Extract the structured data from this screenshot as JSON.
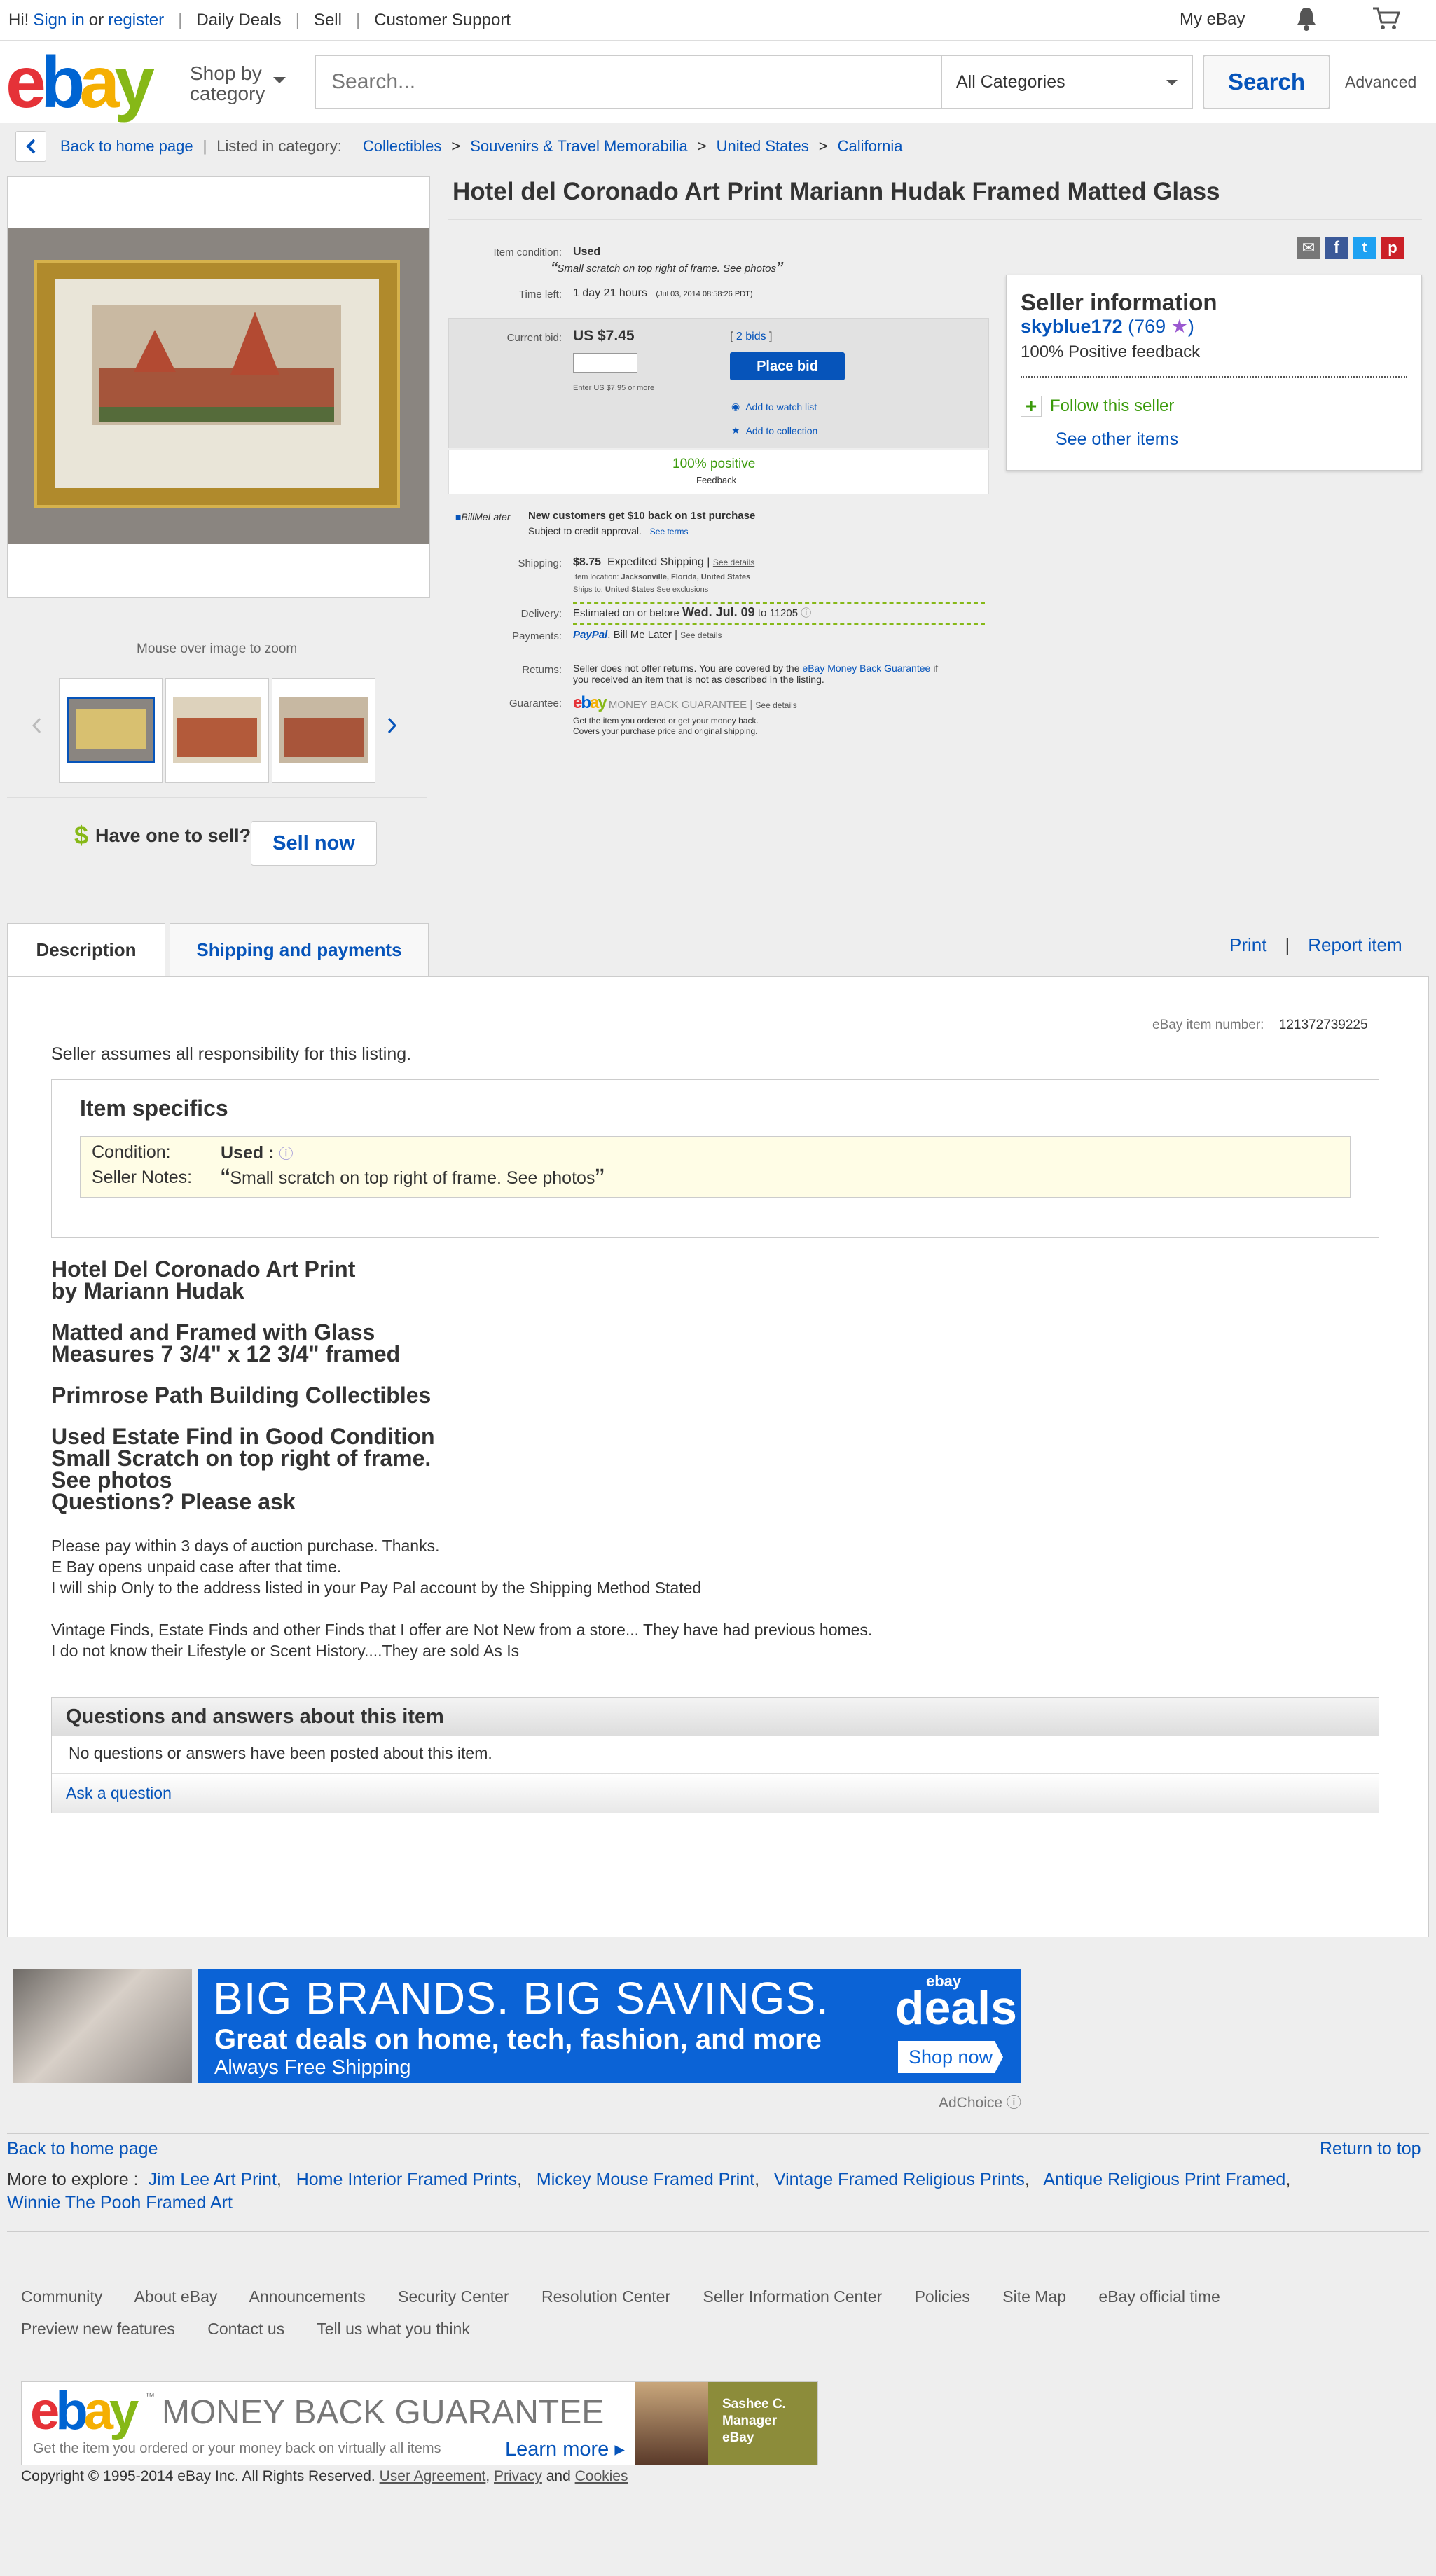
{
  "topbar": {
    "greeting": "Hi!",
    "sign_in": "Sign in",
    "or": "or",
    "register": "register",
    "daily_deals": "Daily Deals",
    "sell": "Sell",
    "support": "Customer Support",
    "my_ebay": "My eBay"
  },
  "header": {
    "logo": {
      "e": "e",
      "b": "b",
      "a": "a",
      "y": "y"
    },
    "shop_by": "Shop by",
    "category": "category",
    "search_placeholder": "Search...",
    "category_select": "All Categories",
    "search_button": "Search",
    "advanced": "Advanced"
  },
  "breadcrumb": {
    "back": "Back to home page",
    "listed_in": "Listed in category:",
    "items": [
      "Collectibles",
      "Souvenirs & Travel Memorabilia",
      "United States",
      "California"
    ],
    "sep": ">"
  },
  "gallery": {
    "zoom_hint": "Mouse over image to zoom"
  },
  "sell_promo": {
    "dollar": "$",
    "text": "Have one to sell?",
    "button": "Sell now"
  },
  "item": {
    "title": "Hotel del Coronado Art Print Mariann Hudak Framed Matted Glass",
    "condition_label": "Item condition:",
    "condition": "Used",
    "condition_note": "Small scratch on top right of frame. See photos",
    "time_left_label": "Time left:",
    "time_left": "1 day 21 hours",
    "time_left_detail": "(Jul 03, 2014   08:58:26 PDT)",
    "current_bid_label": "Current bid:",
    "current_bid": "US $7.45",
    "bids": "2 bids",
    "enter_hint": "Enter US $7.95 or more",
    "place_bid": "Place bid",
    "watch": "Add to watch list",
    "collection": "Add to collection",
    "positive": "100% positive",
    "feedback": "Feedback",
    "bml_logo": "BillMeLater",
    "bml_title": "New customers get $10 back on 1st purchase",
    "bml_sub": "Subject to credit approval.",
    "bml_terms": "See terms",
    "shipping_label": "Shipping:",
    "shipping_cost": "$8.75",
    "shipping_method": "Expedited Shipping",
    "see_details": "See details",
    "item_location": "Item location:",
    "item_location_val": "Jacksonville, Florida, United States",
    "ships_to": "Ships to:",
    "ships_to_val": "United States",
    "see_exclusions": "See exclusions",
    "delivery_label": "Delivery:",
    "delivery_pre": "Estimated on or before",
    "delivery_date": "Wed. Jul. 09",
    "delivery_to": "to 11205",
    "payments_label": "Payments:",
    "paypal": "PayPal",
    "bill_me_later": "Bill Me Later",
    "returns_label": "Returns:",
    "returns_pre": "Seller does not offer returns. You are covered by the",
    "returns_link": "eBay Money Back Guarantee",
    "returns_post": "if you received an item that is not as described in the listing.",
    "guarantee_label": "Guarantee:",
    "guarantee_text": "MONEY BACK GUARANTEE",
    "guarantee_l1": "Get the item you ordered or get your money back.",
    "guarantee_l2": "Covers your purchase price and original shipping."
  },
  "seller": {
    "heading": "Seller information",
    "name": "skyblue172",
    "score_open": "(",
    "score": "769",
    "score_close": ")",
    "positive": "100% Positive feedback",
    "follow": "Follow this seller",
    "other": "See other items"
  },
  "tabs": {
    "description": "Description",
    "shipping": "Shipping and payments",
    "print": "Print",
    "report": "Report item"
  },
  "description": {
    "item_number_label": "eBay item number:",
    "item_number": "121372739225",
    "responsibility": "Seller assumes all responsibility for this listing.",
    "specifics_heading": "Item specifics",
    "condition_label": "Condition:",
    "condition_val": "Used :",
    "notes_label": "Seller Notes:",
    "notes_val": "Small scratch on top right of frame. See photos",
    "headings": [
      [
        "Hotel Del Coronado Art Print",
        "by Mariann Hudak"
      ],
      [
        "Matted and Framed with Glass",
        "Measures 7 3/4\" x 12 3/4\" framed"
      ],
      [
        "Primrose Path Building Collectibles"
      ],
      [
        "Used Estate Find in Good Condition",
        "Small Scratch on top right of frame.",
        "See photos",
        "Questions? Please ask"
      ]
    ],
    "para1": [
      "Please pay within 3 days of auction purchase. Thanks.",
      "E Bay opens unpaid case after that time.",
      "I will ship Only to the address listed in your Pay Pal account by the Shipping Method Stated"
    ],
    "para2": [
      "Vintage Finds, Estate Finds and other Finds that I offer are Not New from a store... They have had previous homes.",
      "I do not know their Lifestyle or Scent History....They are sold As Is"
    ]
  },
  "qa": {
    "heading": "Questions and answers about this item",
    "none": "No questions or answers have been posted about this item.",
    "ask": "Ask a question"
  },
  "ad": {
    "headline": "BIG BRANDS. BIG SAVINGS.",
    "sub": "Great deals on home, tech, fashion, and more",
    "ship": "Always Free Shipping",
    "brand_small": "ebay",
    "brand": "deals",
    "cta": "Shop now",
    "adchoice": "AdChoice"
  },
  "bottom": {
    "back": "Back to home page",
    "top": "Return to top",
    "explore_label": "More to explore :",
    "explore": [
      "Jim Lee Art Print",
      "Home Interior Framed Prints",
      "Mickey Mouse Framed Print",
      "Vintage Framed Religious Prints",
      "Antique Religious Print Framed",
      "Winnie The Pooh Framed Art"
    ]
  },
  "footer": {
    "row1": [
      "Community",
      "About eBay",
      "Announcements",
      "Security Center",
      "Resolution Center",
      "Seller Information Center",
      "Policies",
      "Site Map",
      "eBay official time"
    ],
    "row2": [
      "Preview new features",
      "Contact us",
      "Tell us what you think"
    ],
    "mbg_title": "MONEY BACK GUARANTEE",
    "mbg_tm": "™",
    "mbg_sub": "Get the item you ordered or your money back on virtually all items",
    "mbg_learn": "Learn more",
    "mbg_person": [
      "Sashee C.",
      "Manager",
      "eBay"
    ],
    "copyright": "Copyright © 1995-2014 eBay Inc. All Rights Reserved.",
    "user_agreement": "User Agreement",
    "privacy": "Privacy",
    "and": "and",
    "cookies": "Cookies"
  }
}
